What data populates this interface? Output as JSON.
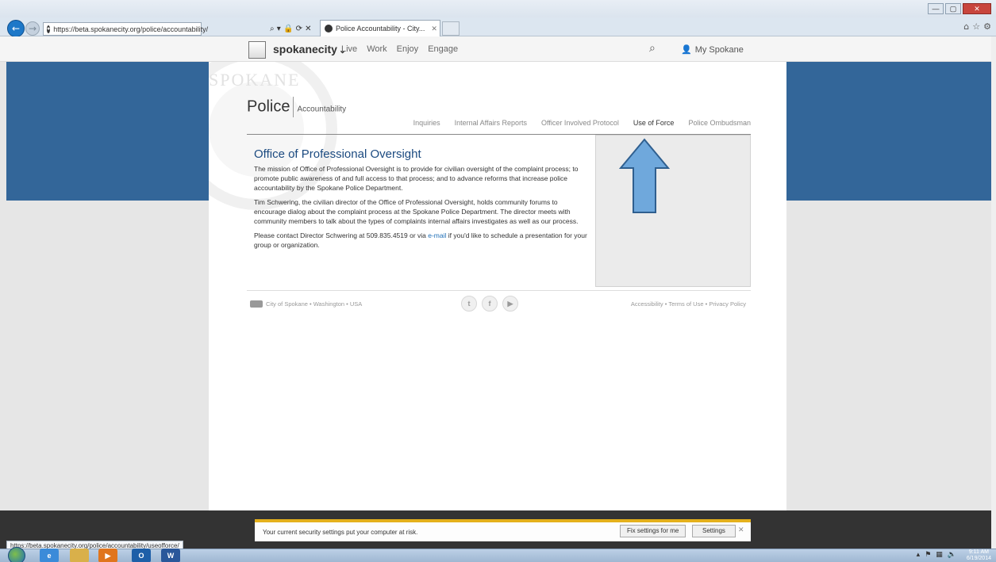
{
  "browser": {
    "url": "https://beta.spokanecity.org/police/accountability/",
    "url_host": "beta.spokanecity.org",
    "tab_title": "Police Accountability - City...",
    "address_tools": "⌕ ▾ 🔒 ⟳ ✕",
    "status_url": "https://beta.spokanecity.org/police/accountability/useofforce/",
    "window_controls": {
      "minimize": "—",
      "maximize": "▢",
      "close": "✕"
    },
    "ie_icons": [
      "home-icon",
      "star-icon",
      "gear-icon"
    ]
  },
  "site": {
    "brand": "spokanecity",
    "brand_chevron": "⌄",
    "nav": [
      "Live",
      "Work",
      "Enjoy",
      "Engage"
    ],
    "account_label": "My Spokane"
  },
  "page": {
    "department": "Police",
    "department_sub": "Accountability",
    "subnav": [
      {
        "label": "Inquiries",
        "active": false
      },
      {
        "label": "Internal Affairs Reports",
        "active": false
      },
      {
        "label": "Officer Involved Protocol",
        "active": false
      },
      {
        "label": "Use of Force",
        "active": true
      },
      {
        "label": "Police Ombudsman",
        "active": false
      }
    ],
    "heading": "Office of Professional Oversight",
    "paragraph1": "The mission of Office of Professional Oversight is to provide for civilian oversight of the complaint process; to promote public awareness of and full access to that process; and to advance reforms that increase police accountability by the Spokane Police Department.",
    "paragraph2": "Tim Schwering, the civilian director of the Office of Professional Oversight, holds community forums to encourage dialog about the complaint process at the Spokane Police Department. The director meets with community members to talk about the types of complaints internal affairs investigates as well as our process.",
    "paragraph3_before": "Please contact Director Schwering at 509.835.4519 or via ",
    "paragraph3_link": "e-mail",
    "paragraph3_after": " if you'd like to schedule a presentation for your group or organization.",
    "watermark_text": "SPOKANE"
  },
  "footer": {
    "left": "City of Spokane  •  Washington  •  USA",
    "social": [
      "twitter-icon",
      "facebook-icon",
      "youtube-icon"
    ],
    "social_glyphs": [
      "t",
      "f",
      "▶"
    ],
    "right": "Accessibility  •  Terms of Use  •  Privacy Policy"
  },
  "notification": {
    "message": "Your current security settings put your computer at risk.",
    "fix_label": "Fix settings for me",
    "settings_label": "Settings",
    "close": "✕"
  },
  "taskbar": {
    "apps": [
      "start",
      "internet-explorer",
      "file-explorer",
      "media-player",
      "outlook",
      "word"
    ],
    "outlook_glyph": "O",
    "word_glyph": "W",
    "clock_time": "9:11 AM",
    "clock_date": "6/19/2014"
  },
  "colors": {
    "blue_band": "#336699",
    "heading": "#1b4a80",
    "arrow_fill": "#6fa8dc",
    "notify_accent": "#e4b01c"
  }
}
